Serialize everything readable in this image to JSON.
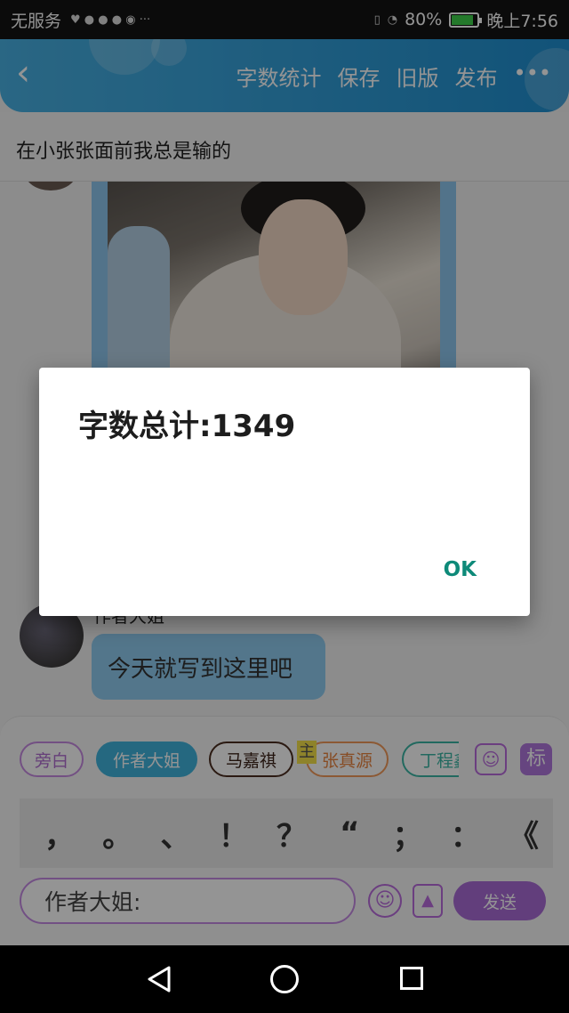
{
  "status_bar": {
    "carrier": "无服务",
    "battery_percent": "80%",
    "battery_level": 0.8,
    "time": "晚上7:56"
  },
  "header": {
    "back_icon": "back-chevron-icon",
    "buttons": [
      "字数统计",
      "保存",
      "旧版",
      "发布"
    ],
    "more_icon": "more-dots-icon"
  },
  "story_title": "在小张张面前我总是输的",
  "chat": {
    "messages": [
      {
        "type": "image",
        "content": "photo"
      },
      {
        "type": "text",
        "sender": "作者大姐",
        "text": "今天就写到这里吧"
      }
    ]
  },
  "roles": [
    "旁白",
    "作者大姐",
    "马嘉祺",
    "张真源",
    "丁程鑫"
  ],
  "role_marker": "主",
  "tools": {
    "role_icon": "person-icon",
    "tag_label": "标"
  },
  "punctuation": [
    "，",
    "。",
    "、",
    "！",
    "？",
    "“",
    "；",
    "：",
    "《"
  ],
  "composer": {
    "input_text": "作者大姐:",
    "emoji_icon": "emoji-icon",
    "image_icon": "image-icon",
    "send_label": "发送"
  },
  "dialog": {
    "title": "字数总计:1349",
    "ok_label": "OK"
  }
}
